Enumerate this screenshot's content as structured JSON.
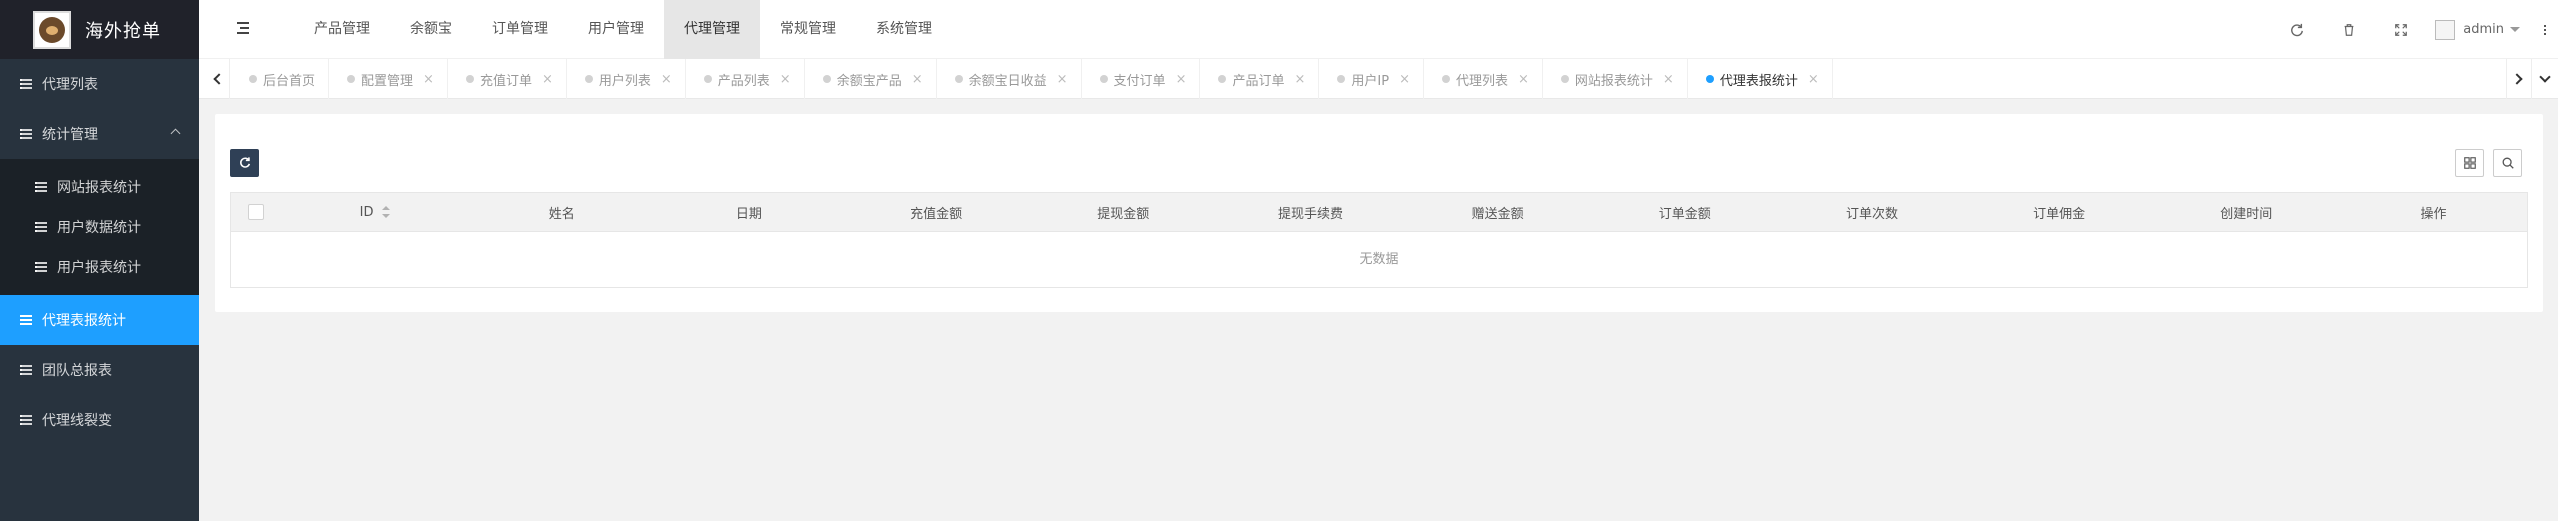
{
  "app": {
    "title": "海外抢单"
  },
  "sidebar": {
    "items": [
      {
        "label": "代理列表"
      },
      {
        "label": "统计管理"
      },
      {
        "label": "代理表报统计"
      },
      {
        "label": "团队总报表"
      },
      {
        "label": "代理线裂变"
      }
    ],
    "sub": [
      {
        "label": "网站报表统计"
      },
      {
        "label": "用户数据统计"
      },
      {
        "label": "用户报表统计"
      }
    ]
  },
  "topnav": [
    {
      "label": "产品管理"
    },
    {
      "label": "余额宝"
    },
    {
      "label": "订单管理"
    },
    {
      "label": "用户管理"
    },
    {
      "label": "代理管理"
    },
    {
      "label": "常规管理"
    },
    {
      "label": "系统管理"
    }
  ],
  "header": {
    "user": "admin"
  },
  "tabs": [
    {
      "label": "后台首页"
    },
    {
      "label": "配置管理",
      "close": "×"
    },
    {
      "label": "充值订单",
      "close": "×"
    },
    {
      "label": "用户列表",
      "close": "×"
    },
    {
      "label": "产品列表",
      "close": "×"
    },
    {
      "label": "余额宝产品",
      "close": "×"
    },
    {
      "label": "余额宝日收益",
      "close": "×"
    },
    {
      "label": "支付订单",
      "close": "×"
    },
    {
      "label": "产品订单",
      "close": "×"
    },
    {
      "label": "用户IP",
      "close": "×"
    },
    {
      "label": "代理列表",
      "close": "×"
    },
    {
      "label": "网站报表统计",
      "close": "×"
    },
    {
      "label": "代理表报统计",
      "close": "×"
    }
  ],
  "table": {
    "columns": [
      "ID",
      "姓名",
      "日期",
      "充值金额",
      "提现金额",
      "提现手续费",
      "赠送金额",
      "订单金额",
      "订单次数",
      "订单佣金",
      "创建时间",
      "操作"
    ],
    "empty": "无数据"
  },
  "colors": {
    "sidebar_bg": "#28333e",
    "active": "#1e9fff",
    "toolbar_btn": "#2f4056"
  }
}
